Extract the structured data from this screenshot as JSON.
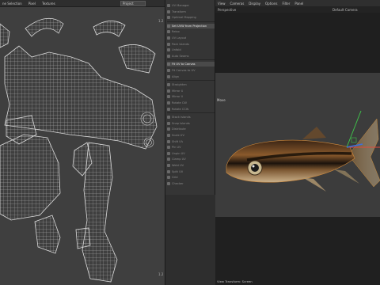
{
  "uv_editor": {
    "menu": [
      "ne Selection",
      "Pixel",
      "Textures"
    ],
    "projection": "Project",
    "corner_top": "1.2",
    "corner_bottom": "1.2"
  },
  "tools": {
    "items": [
      {
        "label": "UV Manager",
        "active": false
      },
      {
        "label": "Transform",
        "active": false
      },
      {
        "label": "Optimal Mapping",
        "active": false
      },
      {
        "label": "Set UVW from Projection",
        "active": true
      },
      {
        "label": "Relax",
        "active": false
      },
      {
        "label": "UV Layout",
        "active": false
      },
      {
        "label": "Pack Islands",
        "active": false
      },
      {
        "label": "Unfold",
        "active": false
      },
      {
        "label": "Auto Seams",
        "active": false
      },
      {
        "label": "Fit UV to Canvas",
        "active": true
      },
      {
        "label": "Fit Canvas to UV",
        "active": false
      },
      {
        "label": "Align",
        "active": false
      },
      {
        "label": "Straighten",
        "active": false
      },
      {
        "label": "Mirror U",
        "active": false
      },
      {
        "label": "Mirror V",
        "active": false
      },
      {
        "label": "Rotate CW",
        "active": false
      },
      {
        "label": "Rotate CCW",
        "active": false
      },
      {
        "label": "Stack Islands",
        "active": false
      },
      {
        "label": "Snap Islands",
        "active": false
      },
      {
        "label": "Distribute",
        "active": false
      },
      {
        "label": "Scale UV",
        "active": false
      },
      {
        "label": "Shift UV",
        "active": false
      },
      {
        "label": "Pin UV",
        "active": false
      },
      {
        "label": "Unpin UV",
        "active": false
      },
      {
        "label": "Clamp UV",
        "active": false
      },
      {
        "label": "Weld UV",
        "active": false
      },
      {
        "label": "Split UV",
        "active": false
      },
      {
        "label": "Grid",
        "active": false
      },
      {
        "label": "Checker",
        "active": false
      }
    ]
  },
  "viewport": {
    "menu": [
      "View",
      "Cameras",
      "Display",
      "Options",
      "Filter",
      "Panel"
    ],
    "view_name": "Perspective",
    "camera_name": "Default Camera",
    "tool_label": "Move",
    "status": "View Transform: Screen"
  },
  "colors": {
    "uv_bg": "#3f3f3f",
    "mesh": "#cfcfcf",
    "gizmo_x": "#e04a3a",
    "gizmo_y": "#3fc04a",
    "gizmo_z": "#3a70e0"
  }
}
